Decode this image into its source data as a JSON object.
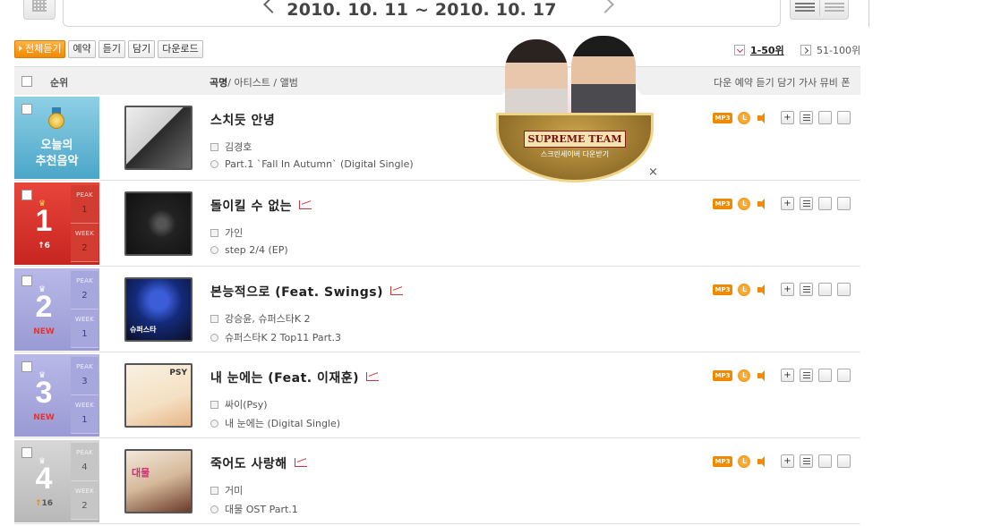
{
  "date_range": "2010. 10. 11 ~ 2010. 10. 17",
  "actions": [
    "전체듣기",
    "예약",
    "듣기",
    "담기",
    "다운로드"
  ],
  "ranges": {
    "current": "1-50위",
    "next": "51-100위"
  },
  "table_header": {
    "rank": "순위",
    "song": "곡명",
    "artist_album": "/ 아티스트 / 앨범",
    "actions": "다운 예약 듣기   담기 가사 뮤비 폰"
  },
  "recommend": {
    "label_line1": "오늘의",
    "label_line2": "추천음악",
    "title": "스치듯 안녕",
    "artist": "김경호",
    "album": "Part.1 `Fall In Autumn` (Digital Single)"
  },
  "songs": [
    {
      "rank": "1",
      "move": "↑6",
      "peak_label": "PEAK",
      "peak": "1",
      "week_label": "WEEK",
      "week": "2",
      "title": "돌이킬 수 없는",
      "artist": "가인",
      "album": "step 2/4 (EP)"
    },
    {
      "rank": "2",
      "move": "NEW",
      "peak_label": "PEAK",
      "peak": "2",
      "week_label": "WEEK",
      "week": "1",
      "title": "본능적으로 (Feat. Swings)",
      "artist": "강승윤, 슈퍼스타K 2",
      "album": "슈퍼스타K 2 Top11 Part.3",
      "cover_text": "슈퍼스타"
    },
    {
      "rank": "3",
      "move": "NEW",
      "peak_label": "PEAK",
      "peak": "3",
      "week_label": "WEEK",
      "week": "1",
      "title": "내 눈에는 (Feat. 이재훈)",
      "artist": "싸이(Psy)",
      "album": "내 눈에는 (Digital Single)",
      "cover_text": "PSY"
    },
    {
      "rank": "4",
      "move": "16",
      "peak_label": "PEAK",
      "peak": "4",
      "week_label": "WEEK",
      "week": "2",
      "title": "죽어도 사랑해",
      "artist": "거미",
      "album": "대물 OST Part.1",
      "cover_text": "대물"
    }
  ],
  "icons": {
    "mp3": "MP3"
  },
  "promo": {
    "name": "SUPREME TEAM",
    "sub": "스크린세이버 다운받기",
    "close": "×"
  },
  "colors": {
    "accent": "#f08a00",
    "rank1": "#d23c31",
    "new_rank": "#a6a7dc",
    "rank4": "#c6c6c6",
    "recommend": "#4aa6c8"
  }
}
